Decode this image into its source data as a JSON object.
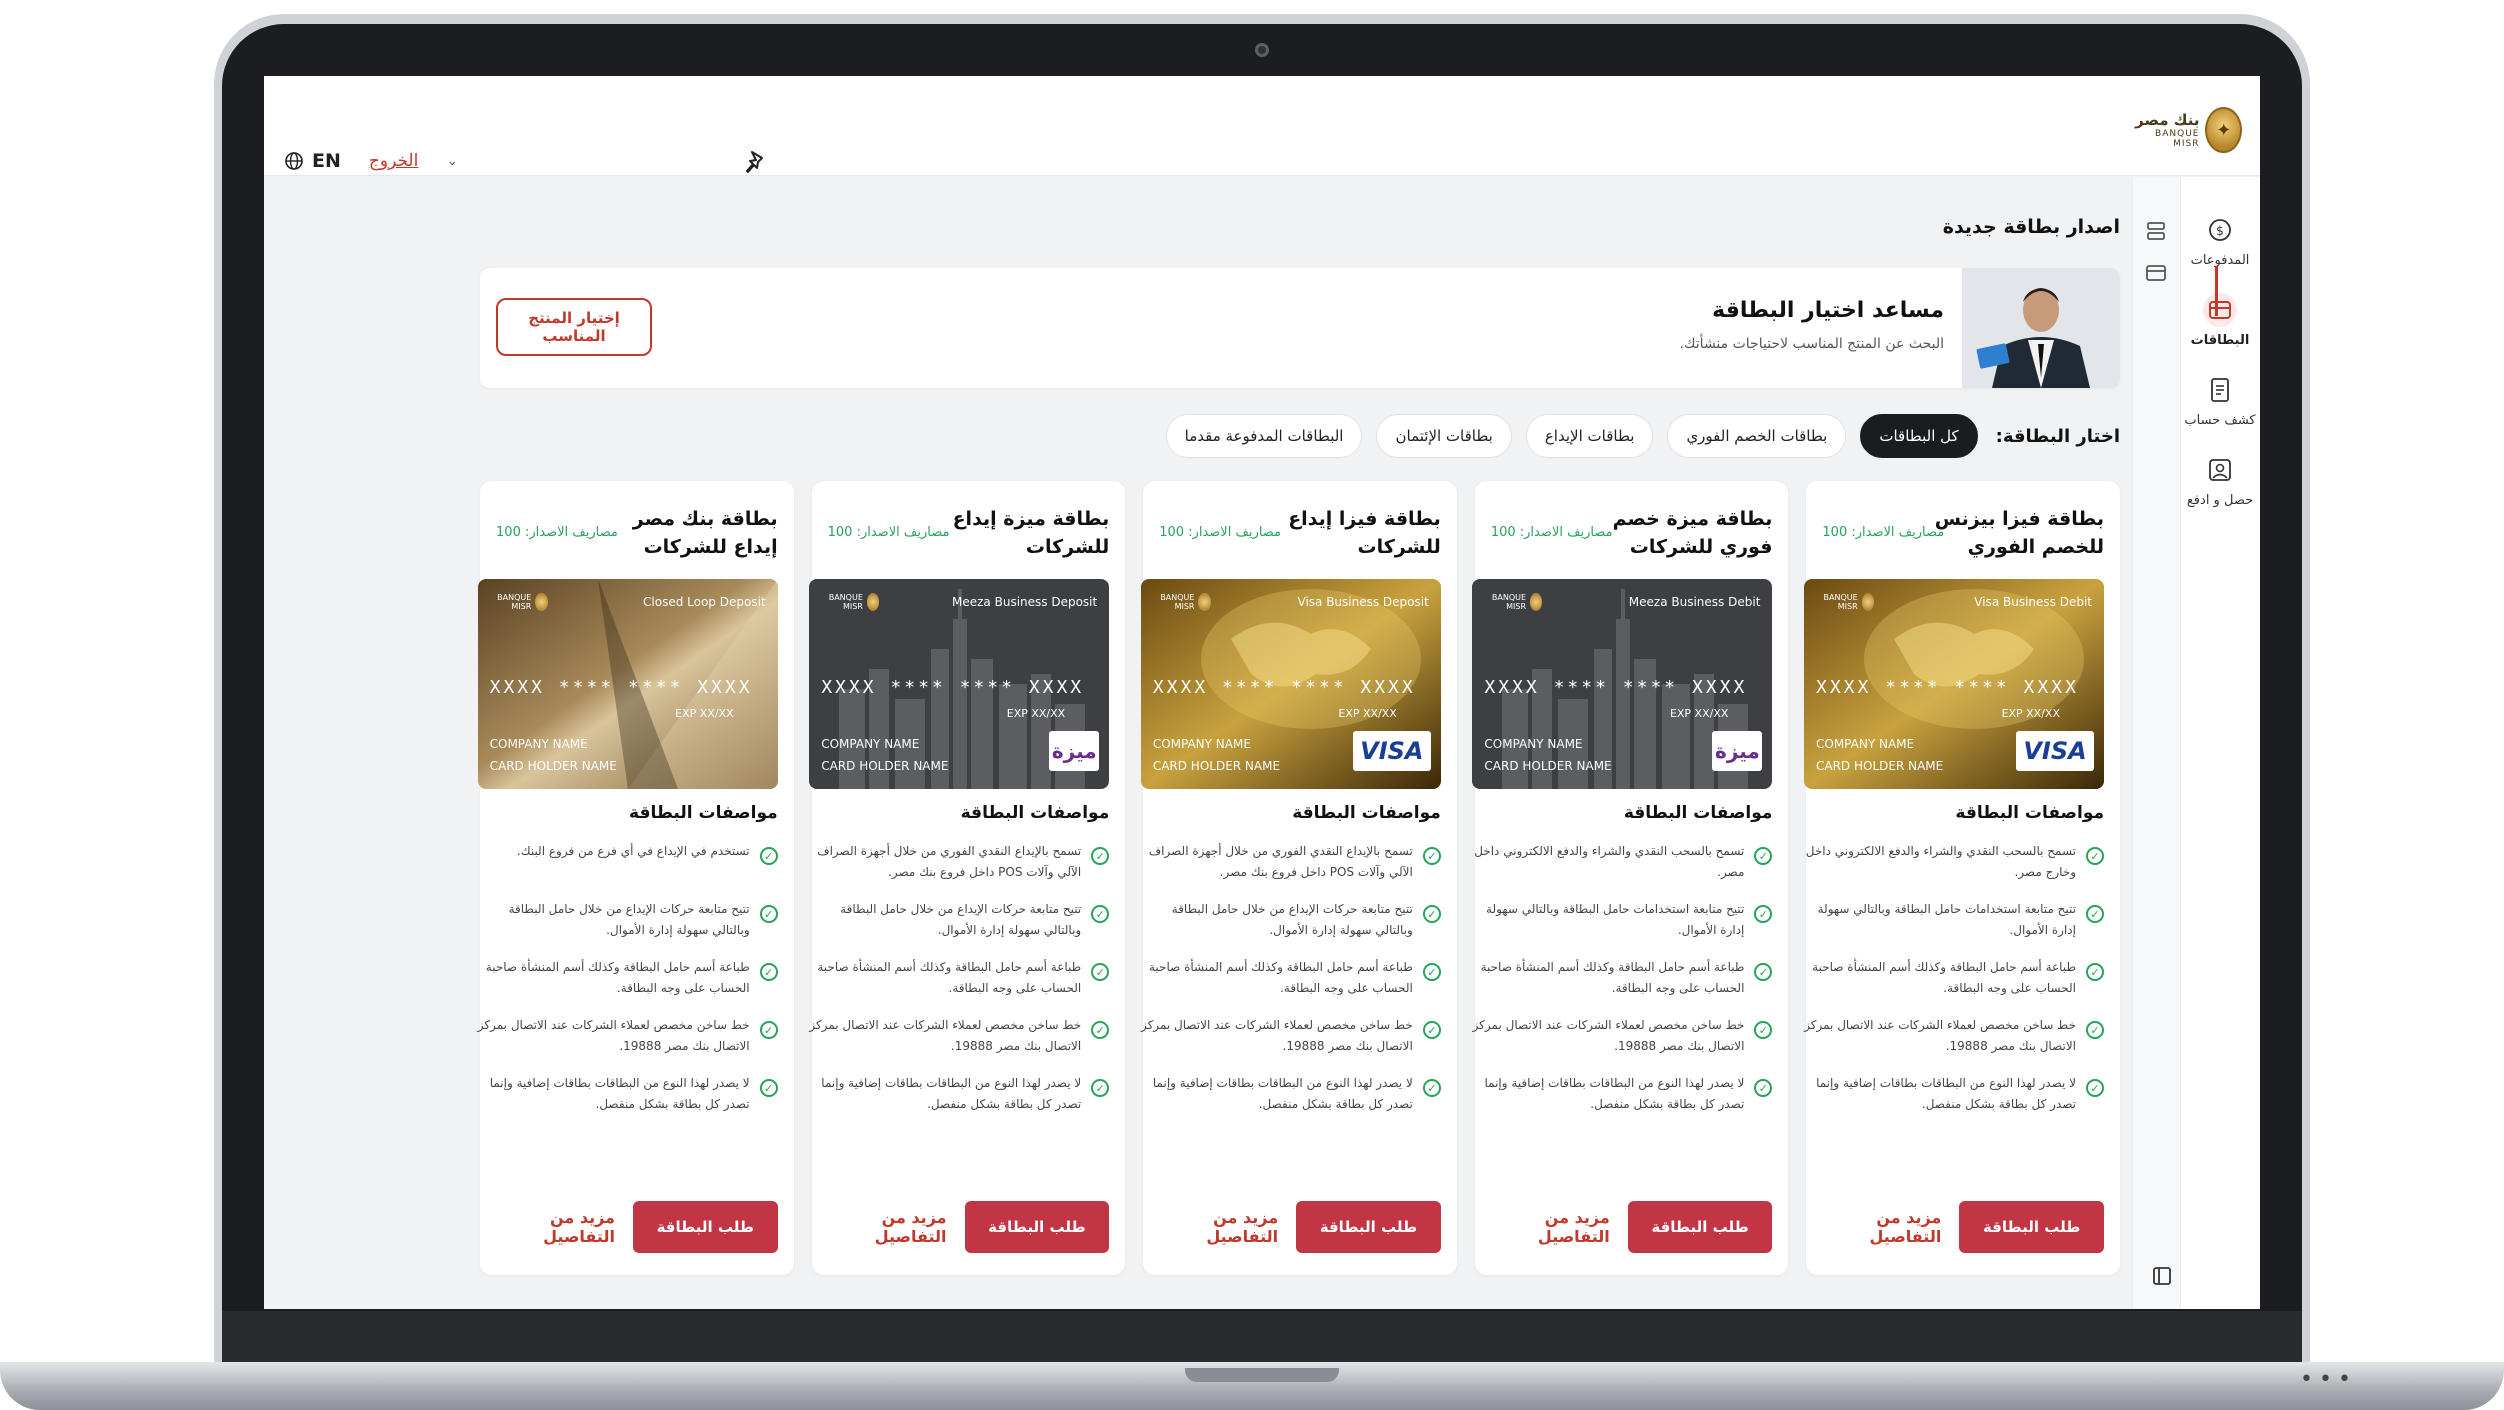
{
  "brand": {
    "name_ar": "بنك مصر",
    "name_en": "BANQUE MISR"
  },
  "header": {
    "lang": "EN",
    "logout": "الخروج"
  },
  "sidebar": {
    "items": [
      {
        "label": "المدفوعات",
        "icon": "payments-icon"
      },
      {
        "label": "البطاقات",
        "icon": "card-icon"
      },
      {
        "label": "كشف حساب",
        "icon": "statement-icon"
      },
      {
        "label": "حصل و ادفع",
        "icon": "collect-pay-icon"
      }
    ]
  },
  "page": {
    "title": "اصدار بطاقة جديدة"
  },
  "assistant": {
    "title": "مساعد اختيار البطاقة",
    "subtitle": "البحث عن المنتج المناسب لاحتياجات منشأتك.",
    "button": "إختيار المنتج المناسب"
  },
  "filters": {
    "label": "اختار البطاقة:",
    "chips": [
      "كل البطاقات",
      "بطاقات الخصم الفوري",
      "بطاقات الإيداع",
      "بطاقات الإئتمان",
      "البطاقات المدفوعة مقدما"
    ]
  },
  "common": {
    "fee": "مصاريف الاصدار: 100",
    "specs_title": "مواصفات البطاقة",
    "more": "مزيد من التفاصيل",
    "request": "طلب البطاقة",
    "card_number": "XXXX **** **** XXXX",
    "card_exp": "EXP XX/XX",
    "company_name": "COMPANY NAME",
    "holder_name": "CARD HOLDER NAME"
  },
  "cards": [
    {
      "title": "بطاقة فيزا بيزنس للخصم الفوري",
      "card_type": "Visa Business Debit",
      "network": "VISA",
      "style": "gold-map",
      "features": [
        "تسمح بالسحب النقدي والشراء والدفع الالكتروني داخل وخارج مصر.",
        "تتيح متابعة استخدامات حامل البطاقة وبالتالي سهولة إدارة الأموال.",
        "طباعة أسم حامل البطاقة وكذلك أسم المنشأة صاحبة الحساب على وجه البطاقة.",
        "خط ساخن مخصص لعملاء الشركات عند الاتصال بمركز الاتصال بنك مصر 19888.",
        "لا يصدر لهذا النوع من البطاقات بطاقات إضافية وإنما تصدر كل بطاقة بشكل منفصل."
      ]
    },
    {
      "title": "بطاقة ميزة خصم فوري للشركات",
      "card_type": "Meeza Business Debit",
      "network": "ميزة",
      "style": "dark-city",
      "features": [
        "تسمح بالسحب النقدي والشراء والدفع الالكتروني داخل مصر.",
        "تتيح متابعة استخدامات حامل البطاقة وبالتالي سهولة إدارة الأموال.",
        "طباعة أسم حامل البطاقة وكذلك أسم المنشأة صاحبة الحساب على وجه البطاقة.",
        "خط ساخن مخصص لعملاء الشركات عند الاتصال بمركز الاتصال بنك مصر 19888.",
        "لا يصدر لهذا النوع من البطاقات بطاقات إضافية وإنما تصدر كل بطاقة بشكل منفصل."
      ]
    },
    {
      "title": "بطاقة فيزا إيداع للشركات",
      "card_type": "Visa Business Deposit",
      "network": "VISA",
      "style": "gold-map",
      "features": [
        "تسمح بالإيداع النقدي الفوري من خلال أجهزة الصراف الآلي وآلات POS داخل فروع بنك مصر.",
        "تتيح متابعة حركات الإيداع من خلال حامل البطاقة وبالتالي سهولة إدارة الأموال.",
        "طباعة أسم حامل البطاقة وكذلك أسم المنشأة صاحبة الحساب على وجه البطاقة.",
        "خط ساخن مخصص لعملاء الشركات عند الاتصال بمركز الاتصال بنك مصر 19888.",
        "لا يصدر لهذا النوع من البطاقات بطاقات إضافية وإنما تصدر كل بطاقة بشكل منفصل."
      ]
    },
    {
      "title": "بطاقة ميزة إيداع للشركات",
      "card_type": "Meeza Business Deposit",
      "network": "ميزة",
      "style": "dark-city",
      "features": [
        "تسمح بالإيداع النقدي الفوري من خلال أجهزة الصراف الآلي وآلات POS داخل فروع بنك مصر.",
        "تتيح متابعة حركات الإيداع من خلال حامل البطاقة وبالتالي سهولة إدارة الأموال.",
        "طباعة أسم حامل البطاقة وكذلك أسم المنشأة صاحبة الحساب على وجه البطاقة.",
        "خط ساخن مخصص لعملاء الشركات عند الاتصال بمركز الاتصال بنك مصر 19888.",
        "لا يصدر لهذا النوع من البطاقات بطاقات إضافية وإنما تصدر كل بطاقة بشكل منفصل."
      ]
    },
    {
      "title": "بطاقة بنك مصر إيداع للشركات",
      "card_type": "Closed Loop Deposit",
      "network": "",
      "style": "gold-plain",
      "features": [
        "تستخدم في الإيداع في أي فرع من فروع البنك.",
        "تتيح متابعة حركات الإيداع من خلال حامل البطاقة وبالتالي سهولة إدارة الأموال.",
        "طباعة أسم حامل البطاقة وكذلك أسم المنشأة صاحبة الحساب على وجه البطاقة.",
        "خط ساخن مخصص لعملاء الشركات عند الاتصال بمركز الاتصال بنك مصر 19888.",
        "لا يصدر لهذا النوع من البطاقات بطاقات إضافية وإنما تصدر كل بطاقة بشكل منفصل."
      ]
    }
  ]
}
